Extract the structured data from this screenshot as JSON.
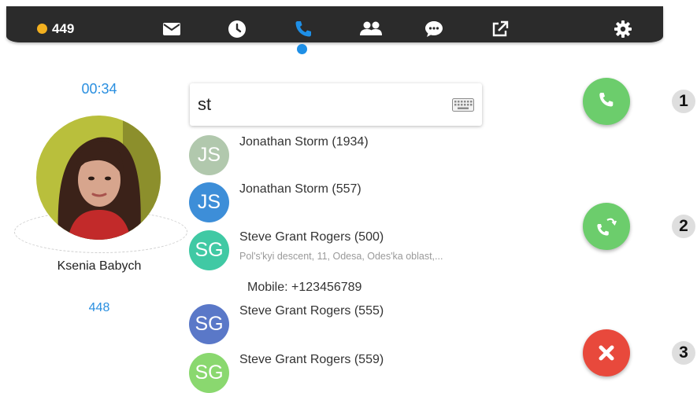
{
  "topbar": {
    "status_color": "#f3b01f",
    "status_count": "449",
    "icons": [
      "mail-icon",
      "clock-icon",
      "phone-icon",
      "contacts-icon",
      "chat-icon",
      "external-link-icon",
      "gear-icon"
    ],
    "active_icon": "phone-icon",
    "active_color": "#1e8fe6"
  },
  "caller": {
    "timer": "00:34",
    "name": "Ksenia Babych",
    "extension": "448"
  },
  "search": {
    "value": "st"
  },
  "contacts": [
    {
      "initials": "JS",
      "name": "Jonathan Storm (1934)",
      "color": "#b1c8ad"
    },
    {
      "initials": "JS",
      "name": "Jonathan Storm (557)",
      "color": "#3d8ed8"
    },
    {
      "initials": "SG",
      "name": "Steve Grant Rogers (500)",
      "address": "Pol's'kyi descent, 11, Odesa, Odes'ka oblast,...",
      "mobile": "Mobile: +123456789",
      "color": "#40c9a4"
    },
    {
      "initials": "SG",
      "name": "Steve Grant Rogers (555)",
      "color": "#5a78c8"
    },
    {
      "initials": "SG",
      "name": "Steve Grant Rogers (559)",
      "color": "#8ad86f"
    }
  ],
  "actions": [
    {
      "marker": "1",
      "icon": "phone-icon",
      "color": "#6ccd6c"
    },
    {
      "marker": "2",
      "icon": "transfer-call-icon",
      "color": "#6ccd6c"
    },
    {
      "marker": "3",
      "icon": "close-icon",
      "color": "#e8493c"
    }
  ]
}
